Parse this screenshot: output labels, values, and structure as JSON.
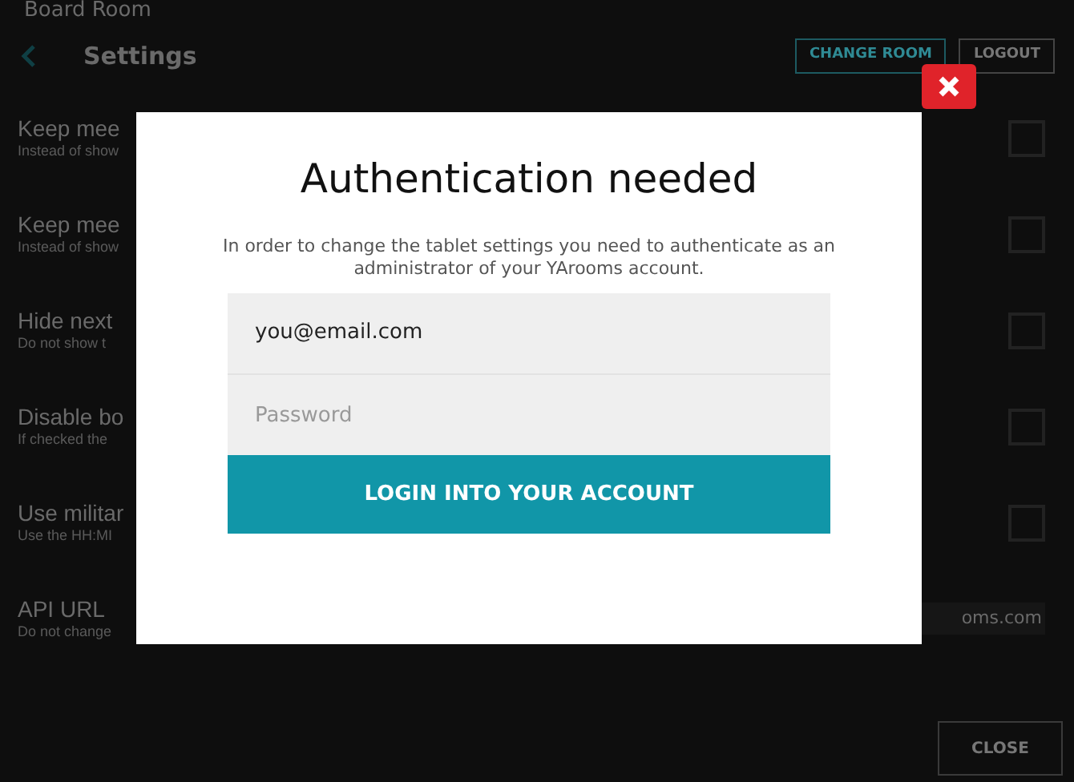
{
  "header": {
    "room": "Board Room",
    "title": "Settings",
    "buttons": [
      "CHANGE ROOM",
      "LOGOUT"
    ]
  },
  "settings": [
    {
      "kind": "checkbox",
      "title": "Keep mee",
      "subtitle": "Instead of show",
      "checked": false
    },
    {
      "kind": "checkbox",
      "title": "Keep mee",
      "subtitle": "Instead of show",
      "checked": false
    },
    {
      "kind": "checkbox",
      "title": "Hide next",
      "subtitle": "Do not show t",
      "checked": false
    },
    {
      "kind": "checkbox",
      "title": "Disable bo",
      "subtitle": "If checked the",
      "checked": false
    },
    {
      "kind": "checkbox",
      "title": "Use militar",
      "subtitle": "Use the HH:MI",
      "checked": false
    },
    {
      "kind": "field",
      "title": "API URL",
      "subtitle": "Do not change",
      "value": "oms.com"
    }
  ],
  "close_button": "CLOSE",
  "dialog": {
    "title": "Authentication needed",
    "message": "In order to change the tablet settings you need to authenticate as an administrator of your YArooms account.",
    "email": "you@email.com",
    "password_placeholder": "Password",
    "submit": "LOGIN INTO YOUR ACCOUNT"
  }
}
